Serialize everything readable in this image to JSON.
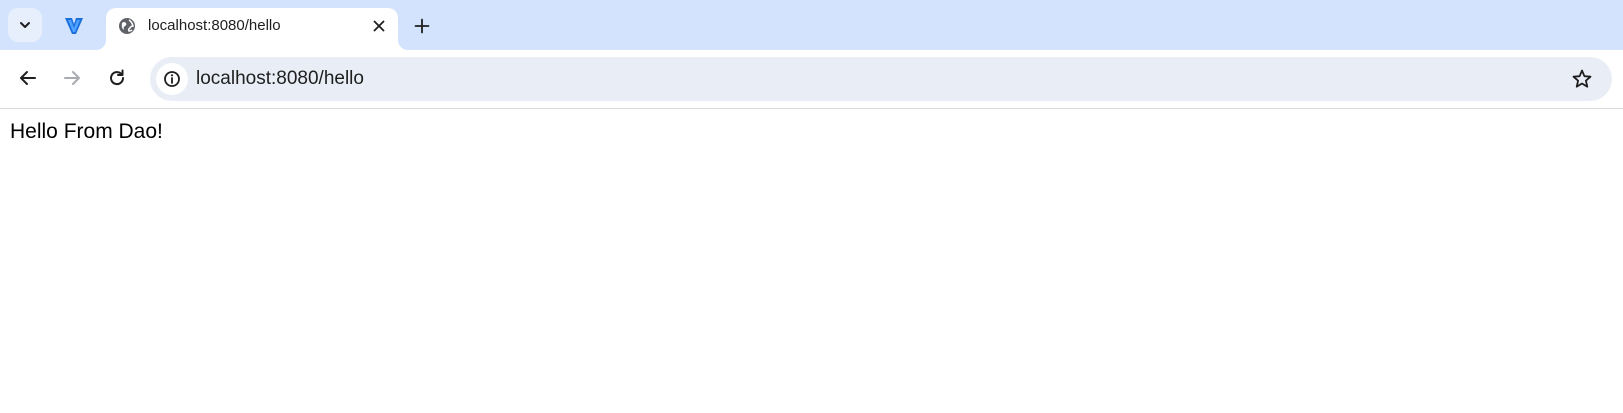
{
  "browser": {
    "tab_search_icon": "chevron-down-icon",
    "pinned_tab": {
      "icon": "pinned-app-logo-icon"
    },
    "active_tab": {
      "title": "localhost:8080/hello",
      "favicon": "globe-icon",
      "close_icon": "close-icon"
    },
    "new_tab_icon": "plus-icon",
    "toolbar": {
      "back_icon": "arrow-left-icon",
      "forward_icon": "arrow-right-icon",
      "reload_icon": "reload-icon",
      "site_info_icon": "info-icon",
      "address": "localhost:8080/hello",
      "bookmark_icon": "star-outline-icon"
    },
    "colors": {
      "tabstrip_bg": "#d3e3fd",
      "omnibox_bg": "#e9eef6",
      "forward_disabled": "#a8abaf"
    }
  },
  "page": {
    "body_text": "Hello From Dao!"
  }
}
